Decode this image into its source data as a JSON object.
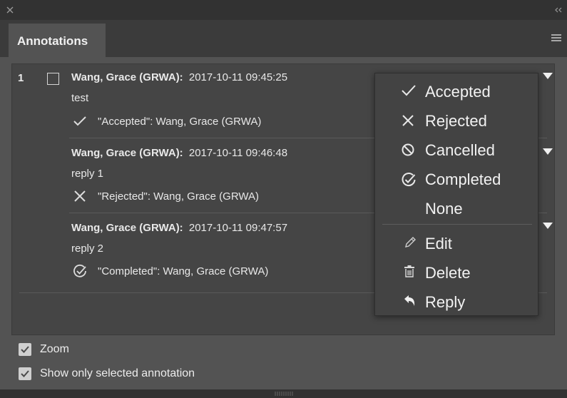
{
  "panel": {
    "tab_label": "Annotations"
  },
  "annotation": {
    "number": "1",
    "entries": [
      {
        "author": "Wang, Grace (GRWA):",
        "time": "2017-10-11 09:45:25",
        "text": "test",
        "status_icon": "check-icon",
        "status_text": "\"Accepted\": Wang, Grace (GRWA)"
      },
      {
        "author": "Wang, Grace (GRWA):",
        "time": "2017-10-11 09:46:48",
        "text": "reply 1",
        "status_icon": "x-mark-icon",
        "status_text": "\"Rejected\": Wang, Grace (GRWA)"
      },
      {
        "author": "Wang, Grace (GRWA):",
        "time": "2017-10-11 09:47:57",
        "text": "reply 2",
        "status_icon": "completed-check-circle-icon",
        "status_text": "\"Completed\": Wang, Grace (GRWA)"
      }
    ]
  },
  "menu": {
    "items": [
      {
        "label": "Accepted",
        "icon": "check-icon"
      },
      {
        "label": "Rejected",
        "icon": "x-mark-icon"
      },
      {
        "label": "Cancelled",
        "icon": "prohibited-circle-icon"
      },
      {
        "label": "Completed",
        "icon": "completed-check-circle-icon"
      },
      {
        "label": "None",
        "icon": ""
      },
      {
        "label": "Edit",
        "icon": "pencil-icon"
      },
      {
        "label": "Delete",
        "icon": "trash-icon"
      },
      {
        "label": "Reply",
        "icon": "reply-arrow-icon"
      }
    ]
  },
  "options": {
    "zoom_label": "Zoom",
    "zoom_checked": true,
    "show_selected_label": "Show only selected annotation",
    "show_selected_checked": true
  },
  "colors": {
    "panel_bg": "#535353",
    "list_bg": "#454545",
    "menu_bg": "#434343",
    "text": "#e8e8e8"
  }
}
